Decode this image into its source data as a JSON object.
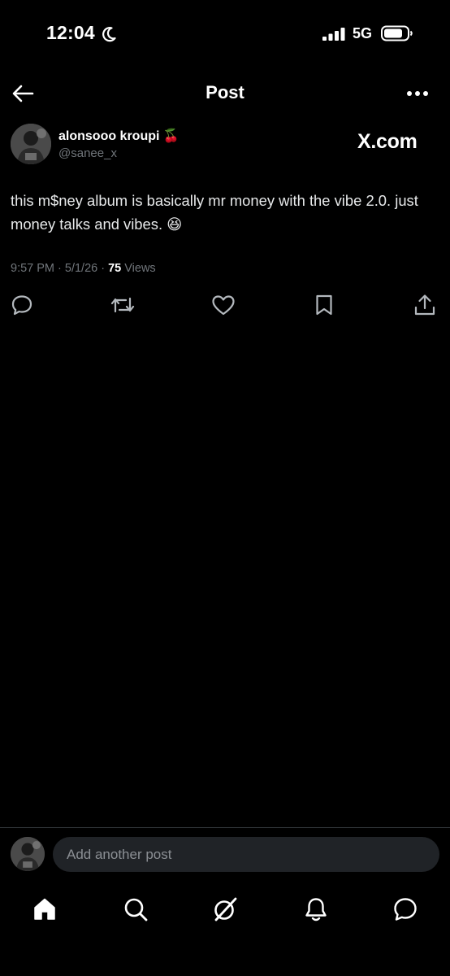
{
  "status_bar": {
    "time": "12:04",
    "network": "5G",
    "icons": [
      "moon-icon",
      "signal-icon",
      "battery-icon"
    ]
  },
  "header": {
    "title": "Post",
    "back_icon": "back-arrow-icon",
    "more_icon": "more-dots-icon"
  },
  "post": {
    "author": {
      "name": "alonsooo kroupi",
      "name_emoji": "🍒",
      "handle": "@sanee_x"
    },
    "source_badge": "X.com",
    "text": "this m$ney album is basically mr money with the vibe 2.0. just money talks and vibes. 😆",
    "timestamp": "9:57 PM · 5/1/26 · ",
    "views_count": "75",
    "views_label": " Views",
    "actions": [
      "reply-icon",
      "repost-icon",
      "like-icon",
      "bookmark-icon",
      "share-icon"
    ]
  },
  "composer": {
    "placeholder": "Add another post"
  },
  "tab_bar": {
    "items": [
      "home-icon",
      "search-icon",
      "grok-icon",
      "notifications-icon",
      "messages-icon"
    ]
  },
  "colors": {
    "background": "#000000",
    "text_primary": "#e7e9ea",
    "text_secondary": "#71767b",
    "input_bg": "#202327"
  }
}
